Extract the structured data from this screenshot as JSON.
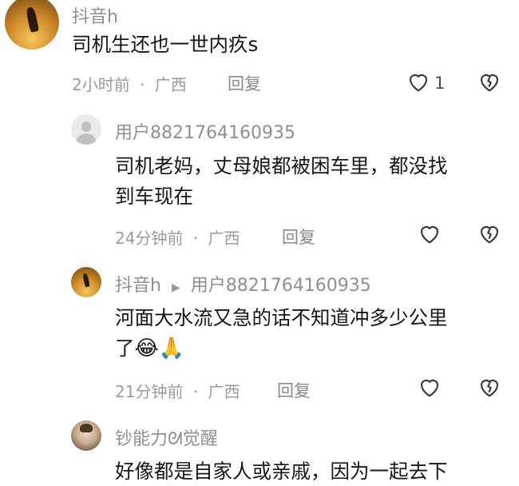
{
  "comments": [
    {
      "user": "抖音h",
      "text": "司机生还也一世内疚s",
      "time": "2小时前",
      "location": "广西",
      "reply_label": "回复",
      "likes": "1"
    },
    {
      "user": "用户8821764160935",
      "text_line1": "司机老妈，丈母娘都被困车里，都没找",
      "text_line2": "到车现在",
      "time": "24分钟前",
      "location": "广西",
      "reply_label": "回复"
    },
    {
      "user": "抖音h",
      "reply_to": "用户8821764160935",
      "text_line1": "河面大水流又急的话不知道冲多少公里",
      "text_line2": "了",
      "emojis": "😂🙏",
      "time": "21分钟前",
      "location": "广西",
      "reply_label": "回复"
    },
    {
      "user": "钞能力ᘛ觉醒",
      "text": "好像都是自家人或亲戚，因为一起去下"
    }
  ],
  "separator": "·",
  "icons": {
    "like": "heart-outline-icon",
    "dislike": "broken-heart-icon",
    "reply_arrow": "play-triangle-icon"
  }
}
